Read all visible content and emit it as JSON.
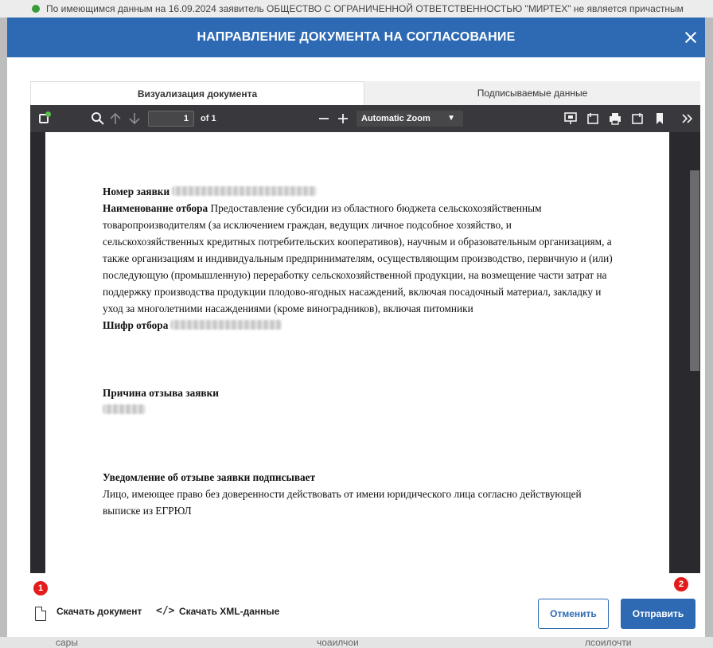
{
  "background": {
    "notice": "По имеющимся данным на 16.09.2024 заявитель ОБЩЕСТВО С ОГРАНИЧЕННОЙ ОТВЕТСТВЕННОСТЬЮ \"МИРТЕХ\" не является причастным",
    "bottom_items": [
      "сары",
      "чоаилчои",
      "лсоилочти"
    ]
  },
  "modal": {
    "title": "НАПРАВЛЕНИЕ ДОКУМЕНТА НА СОГЛАСОВАНИЕ",
    "tabs": [
      {
        "label": "Визуализация документа",
        "active": true
      },
      {
        "label": "Подписываемые данные",
        "active": false
      }
    ]
  },
  "viewer": {
    "page_number": "1",
    "page_of": "of 1",
    "zoom": "Automatic Zoom",
    "icons": [
      "sidebar-toggle-icon",
      "search-icon",
      "arrow-up-icon",
      "arrow-down-icon",
      "zoom-out-icon",
      "zoom-in-icon",
      "presentation-icon",
      "open-file-icon",
      "print-icon",
      "download-icon",
      "bookmark-icon",
      "more-tools-icon"
    ]
  },
  "document": {
    "number_label": "Номер заявки",
    "selection_label": "Наименование отбора",
    "selection_text": "Предоставление субсидии из областного бюджета сельскохозяйственным товаропроизводителям (за исключением граждан, ведущих личное подсобное хозяйство, и сельскохозяйственных кредитных потребительских кооперативов), научным и образовательным организациям, а также организациям и индивидуальным предпринимателям, осуществляющим производство, первичную и (или) последующую (промышленную) переработку сельскохозяйственной продукции, на возмещение части затрат на поддержку производства продукции плодово-ягодных насаждений, включая посадочный материал, закладку и уход за многолетними насаждениями (кроме виноградников), включая питомники",
    "code_label": "Шифр отбора",
    "reason_label": "Причина отзыва заявки",
    "signer_label": "Уведомление об отзыве заявки подписывает",
    "signer_text": "Лицо, имеющее право без доверенности действовать от имени юридического лица согласно действующей выписке из ЕГРЮЛ"
  },
  "footer": {
    "badge_1": "1",
    "badge_2": "2",
    "download_doc": "Скачать документ",
    "download_xml": "Скачать XML-данные",
    "cancel": "Отменить",
    "send": "Отправить"
  },
  "colors": {
    "header": "#2e6ab3",
    "badge": "#e41b1b",
    "viewer_toolbar": "#38383d"
  }
}
